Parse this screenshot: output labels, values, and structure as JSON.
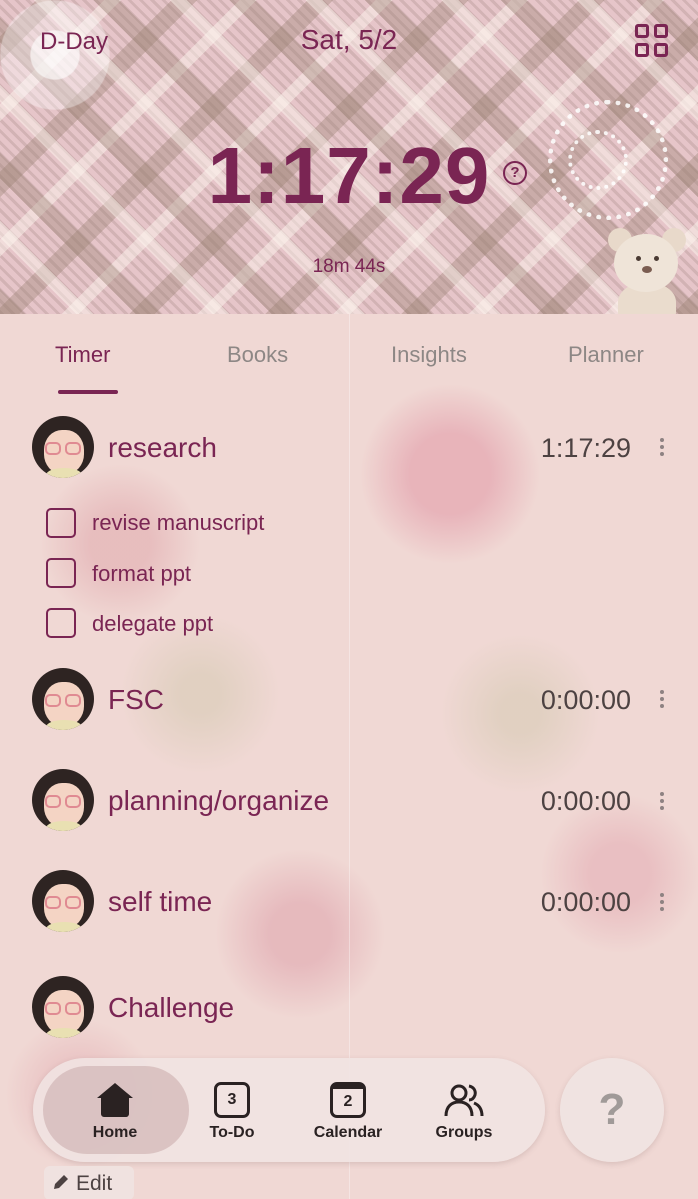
{
  "header": {
    "dday_label": "D-Day",
    "date": "Sat, 5/2",
    "total_time": "1:17:29",
    "sub_time": "18m 44s",
    "help_symbol": "?"
  },
  "tabs": [
    {
      "label": "Timer",
      "active": true
    },
    {
      "label": "Books",
      "active": false
    },
    {
      "label": "Insights",
      "active": false
    },
    {
      "label": "Planner",
      "active": false
    }
  ],
  "subjects": [
    {
      "name": "research",
      "time": "1:17:29",
      "tasks": [
        "revise manuscript",
        "format ppt",
        "delegate ppt"
      ]
    },
    {
      "name": "FSC",
      "time": "0:00:00"
    },
    {
      "name": "planning/organize",
      "time": "0:00:00"
    },
    {
      "name": "self time",
      "time": "0:00:00"
    },
    {
      "name": "Challenge",
      "time": ""
    }
  ],
  "nav": {
    "items": [
      {
        "label": "Home",
        "icon": "home-icon",
        "active": true
      },
      {
        "label": "To-Do",
        "icon": "todo-icon",
        "badge": "3"
      },
      {
        "label": "Calendar",
        "icon": "calendar-icon",
        "badge": "2"
      },
      {
        "label": "Groups",
        "icon": "groups-icon"
      }
    ],
    "help": "?"
  },
  "edit_label": "Edit",
  "colors": {
    "accent": "#7a2553",
    "text_dark": "#2a2222",
    "muted": "#8d8785"
  }
}
